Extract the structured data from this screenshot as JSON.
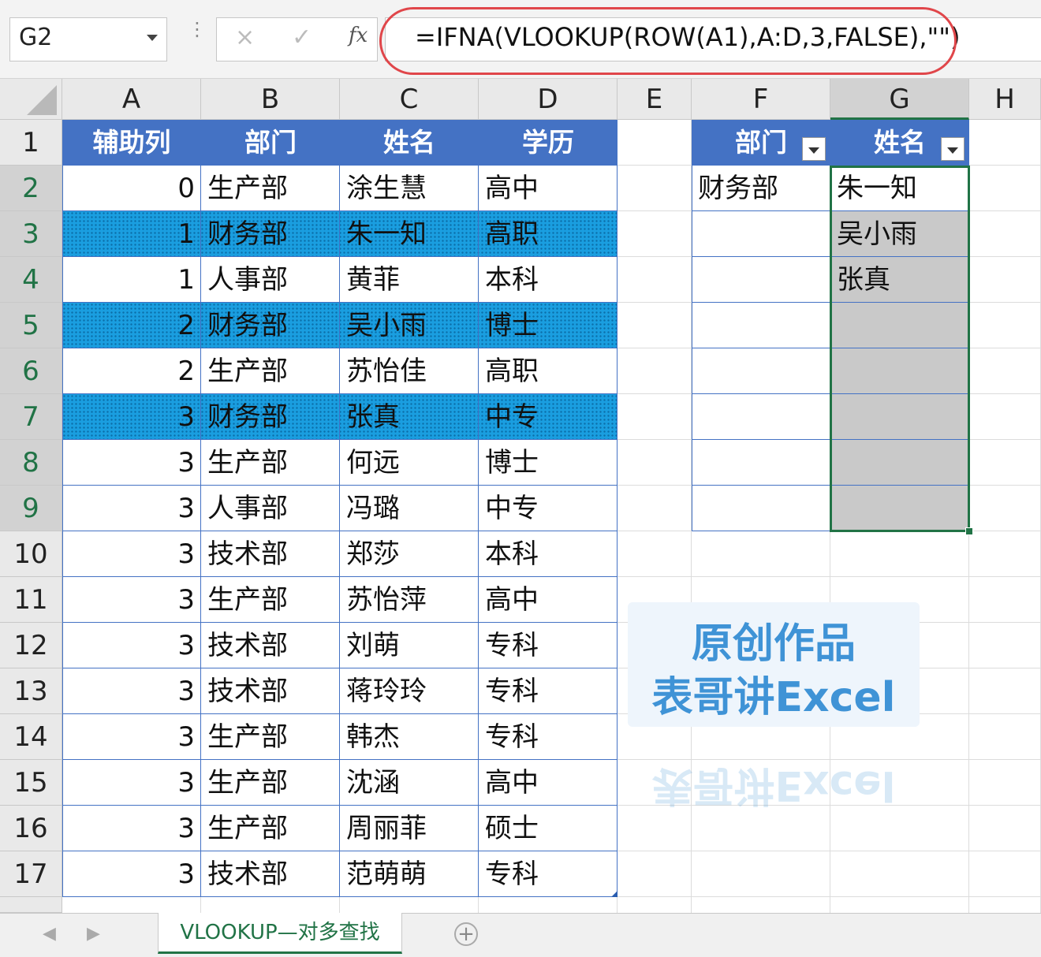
{
  "formula_bar": {
    "name_box": "G2",
    "cancel_glyph": "×",
    "enter_glyph": "✓",
    "fx_glyph": "fx",
    "formula": "=IFNA(VLOOKUP(ROW(A1),A:D,3,FALSE),\"\")"
  },
  "columns": [
    "A",
    "B",
    "C",
    "D",
    "E",
    "F",
    "G",
    "H"
  ],
  "rows": [
    "1",
    "2",
    "3",
    "4",
    "5",
    "6",
    "7",
    "8",
    "9",
    "10",
    "11",
    "12",
    "13",
    "14",
    "15",
    "16",
    "17"
  ],
  "table": {
    "headers": [
      "辅助列",
      "部门",
      "姓名",
      "学历"
    ],
    "rows": [
      [
        "0",
        "生产部",
        "涂生慧",
        "高中"
      ],
      [
        "1",
        "财务部",
        "朱一知",
        "高职"
      ],
      [
        "1",
        "人事部",
        "黄菲",
        "本科"
      ],
      [
        "2",
        "财务部",
        "吴小雨",
        "博士"
      ],
      [
        "2",
        "生产部",
        "苏怡佳",
        "高职"
      ],
      [
        "3",
        "财务部",
        "张真",
        "中专"
      ],
      [
        "3",
        "生产部",
        "何远",
        "博士"
      ],
      [
        "3",
        "人事部",
        "冯璐",
        "中专"
      ],
      [
        "3",
        "技术部",
        "郑莎",
        "本科"
      ],
      [
        "3",
        "生产部",
        "苏怡萍",
        "高中"
      ],
      [
        "3",
        "技术部",
        "刘萌",
        "专科"
      ],
      [
        "3",
        "技术部",
        "蒋玲玲",
        "专科"
      ],
      [
        "3",
        "生产部",
        "韩杰",
        "专科"
      ],
      [
        "3",
        "生产部",
        "沈涵",
        "高中"
      ],
      [
        "3",
        "生产部",
        "周丽菲",
        "硕士"
      ],
      [
        "3",
        "技术部",
        "范萌萌",
        "专科"
      ]
    ]
  },
  "lookup": {
    "headers": [
      "部门",
      "姓名"
    ],
    "dept_value": "财务部",
    "results": [
      "朱一知",
      "吴小雨",
      "张真",
      "",
      "",
      "",
      "",
      ""
    ]
  },
  "watermark": {
    "line1": "原创作品",
    "line2": "表哥讲Excel"
  },
  "sheet_tabs": {
    "nav_left": "◀",
    "nav_right": "▶",
    "active_tab": "VLOOKUP—对多查找",
    "add_sheet": "+"
  },
  "colors": {
    "table_header": "#4472c4",
    "highlight": "#1a9ee0",
    "selection": "#217346",
    "formula_oval": "#e0464a",
    "watermark": "#3f93d6"
  }
}
